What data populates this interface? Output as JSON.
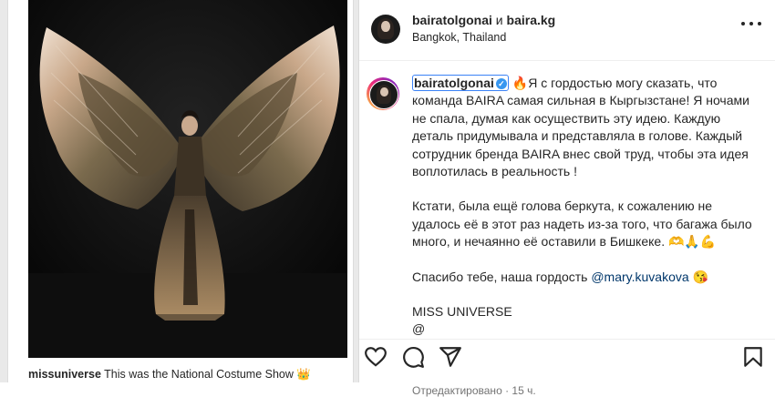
{
  "left": {
    "inner_caption_user": "missuniverse",
    "inner_caption_text": "This was the National Costume Show 👑"
  },
  "header": {
    "user1": "bairatolgonai",
    "joiner": "и",
    "user2": "baira.kg",
    "location": "Bangkok, Thailand"
  },
  "caption": {
    "username": "bairatolgonai",
    "para1": "🔥Я с гордостью могу сказать, что команда BAIRA самая сильная в Кыргызстане! Я ночами не спала, думая как осуществить эту идею. Каждую деталь придумывала и представляла в голове. Каждый сотрудник бренда BAIRA внес свой труд, чтобы эта идея воплотилась в реальность !",
    "para2": "Кстати, была ещё голова беркута, к сожалению не удалось её в этот раз надеть из-за того, что багажа было много, и нечаянно её оставили в Бишкеке. 🫶🙏💪",
    "para3_prefix": "Спасибо тебе, наша гордость",
    "para3_mention": "@mary.kuvakova",
    "para3_emoji": "😘",
    "line4": "MISS UNIVERSE",
    "line5": "@",
    "edited_label": "Отредактировано",
    "time": "15 ч."
  },
  "icons": {
    "verified": "verified-badge-icon",
    "like": "heart-icon",
    "comment": "comment-icon",
    "share": "share-icon",
    "save": "bookmark-icon",
    "more": "more-options-icon"
  },
  "colors": {
    "link": "#00376b",
    "verified": "#3897f0",
    "muted": "#737373"
  }
}
